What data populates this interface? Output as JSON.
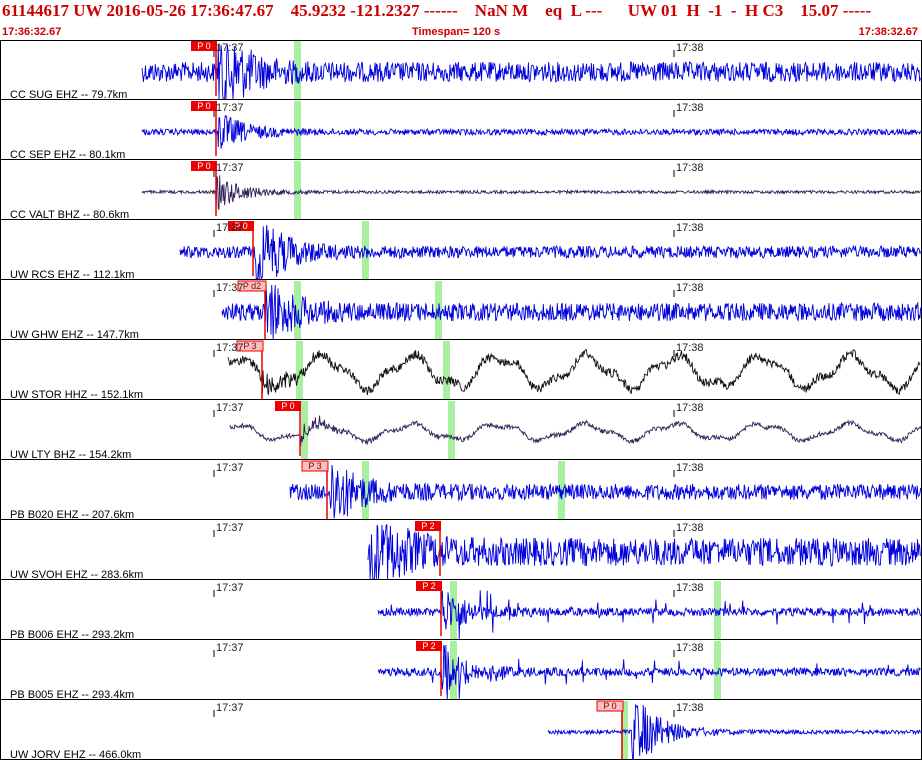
{
  "header": {
    "line1": "61144617 UW 2016-05-26 17:36:47.67    45.9232 -121.2327 ------    NaN M    eq  L ---      UW 01  H  -1  -  H C3    15.07 -----",
    "start_time": "17:36:32.67",
    "timespan": "Timespan= 120 s",
    "end_time": "17:38:32.67"
  },
  "time_labels": {
    "minute_37": "17:37",
    "minute_38": "17:38"
  },
  "colors": {
    "header_red": "#cc0000",
    "trace_blue": "#0000dd",
    "trace_black": "#111111",
    "trace_purple": "#33205a",
    "pick_red": "#ee0000",
    "pick_pale": "#f8c0c0",
    "window_green": "#a8f0a0"
  },
  "channels": [
    {
      "label": "CC SUG EHZ -- 79.7km",
      "pick_label": "P 0",
      "pick_style": "solid",
      "trace_color": "blue"
    },
    {
      "label": "CC SEP EHZ -- 80.1km",
      "pick_label": "P 0",
      "pick_style": "solid",
      "trace_color": "blue"
    },
    {
      "label": "CC VALT BHZ -- 80.6km",
      "pick_label": "P 0",
      "pick_style": "solid",
      "trace_color": "purple"
    },
    {
      "label": "UW RCS EHZ -- 112.1km",
      "pick_label": "P 0",
      "pick_style": "solid",
      "trace_color": "blue"
    },
    {
      "label": "UW GHW EHZ -- 147.7km",
      "pick_label": "P d2",
      "pick_style": "pale",
      "trace_color": "blue"
    },
    {
      "label": "UW STOR HHZ -- 152.1km",
      "pick_label": "P 3",
      "pick_style": "pale",
      "trace_color": "black"
    },
    {
      "label": "UW LTY BHZ -- 154.2km",
      "pick_label": "P 0",
      "pick_style": "solid",
      "trace_color": "purple"
    },
    {
      "label": "PB B020 EHZ -- 207.6km",
      "pick_label": "P 3",
      "pick_style": "pale",
      "trace_color": "blue"
    },
    {
      "label": "UW SVOH EHZ -- 283.6km",
      "pick_label": "P 2",
      "pick_style": "solid",
      "trace_color": "blue"
    },
    {
      "label": "PB B006 EHZ -- 293.2km",
      "pick_label": "P 2",
      "pick_style": "solid",
      "trace_color": "blue"
    },
    {
      "label": "PB B005 EHZ -- 293.4km",
      "pick_label": "P 2",
      "pick_style": "solid",
      "trace_color": "blue"
    },
    {
      "label": "UW JORV EHZ -- 466.0km",
      "pick_label": "P 0",
      "pick_style": "pale",
      "trace_color": "blue"
    }
  ]
}
